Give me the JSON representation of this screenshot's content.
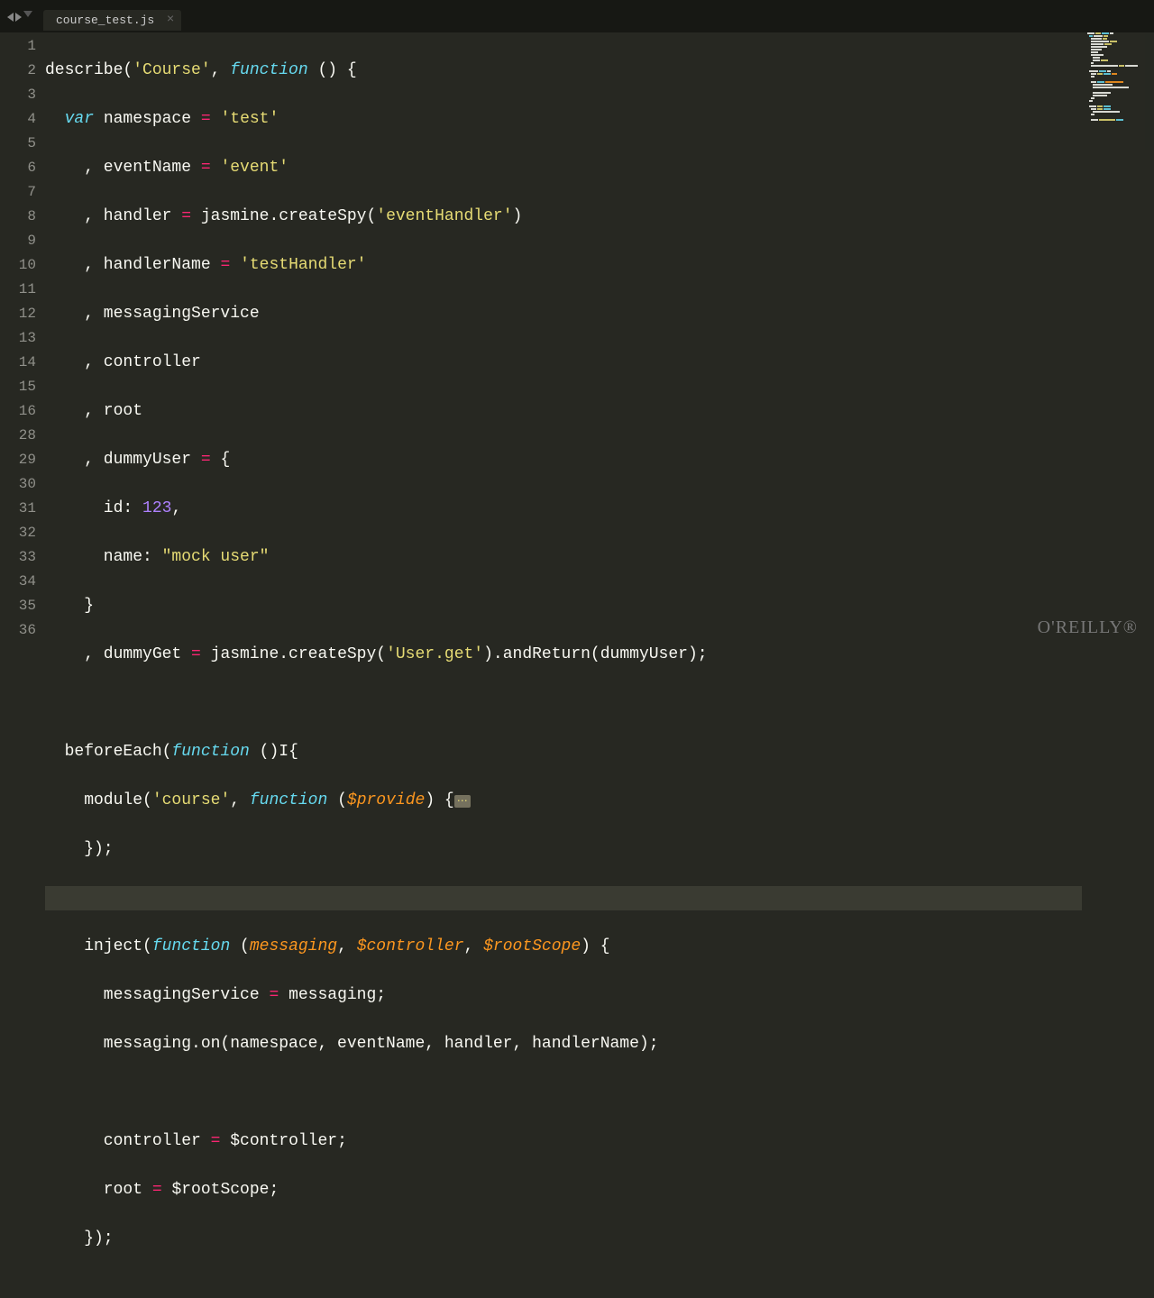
{
  "tab": {
    "name": "course_test.js"
  },
  "gutter": [
    "1",
    "2",
    "3",
    "4",
    "5",
    "6",
    "7",
    "8",
    "9",
    "10",
    "11",
    "12",
    "13",
    "14",
    "15",
    "16",
    "28",
    "29",
    "30",
    "31",
    "32",
    "33",
    "34",
    "35",
    "36"
  ],
  "code": {
    "l1": {
      "a": "describe(",
      "b": "'Course'",
      "c": ", ",
      "d": "function",
      "e": " () {"
    },
    "l2": {
      "a": "  ",
      "b": "var",
      "c": " namespace ",
      "d": "=",
      "e": " ",
      "f": "'test'"
    },
    "l3": {
      "a": "    , eventName ",
      "b": "=",
      "c": " ",
      "d": "'event'"
    },
    "l4": {
      "a": "    , handler ",
      "b": "=",
      "c": " jasmine.createSpy(",
      "d": "'eventHandler'",
      "e": ")"
    },
    "l5": {
      "a": "    , handlerName ",
      "b": "=",
      "c": " ",
      "d": "'testHandler'"
    },
    "l6": {
      "a": "    , messagingService"
    },
    "l7": {
      "a": "    , controller"
    },
    "l8": {
      "a": "    , root"
    },
    "l9": {
      "a": "    , dummyUser ",
      "b": "=",
      "c": " {"
    },
    "l10": {
      "a": "      id: ",
      "b": "123",
      "c": ","
    },
    "l11": {
      "a": "      name: ",
      "b": "\"mock user\""
    },
    "l12": {
      "a": "    }"
    },
    "l13": {
      "a": "    , dummyGet ",
      "b": "=",
      "c": " jasmine.createSpy(",
      "d": "'User.get'",
      "e": ").andReturn(dummyUser);"
    },
    "l14": {
      "a": ""
    },
    "l15": {
      "a": "  beforeEach(",
      "b": "function",
      "c": " ()",
      "cur": "I",
      "d": "{"
    },
    "l16": {
      "a": "    module(",
      "b": "'course'",
      "c": ", ",
      "d": "function",
      "e": " (",
      "f": "$provide",
      "g": ") {",
      "fold": "⋯"
    },
    "l28": {
      "a": "    });"
    },
    "l29": {
      "a": ""
    },
    "l30": {
      "a": "    inject(",
      "b": "function",
      "c": " (",
      "d": "messaging",
      "e": ", ",
      "f": "$controller",
      "g": ", ",
      "h": "$rootScope",
      "i": ") {"
    },
    "l31": {
      "a": "      messagingService ",
      "b": "=",
      "c": " messaging;"
    },
    "l32": {
      "a": "      messaging.on(namespace, eventName, handler, handlerName);"
    },
    "l33": {
      "a": ""
    },
    "l34": {
      "a": "      controller ",
      "b": "=",
      "c": " $controller;"
    },
    "l35": {
      "a": "      root ",
      "b": "=",
      "c": " $rootScope;"
    },
    "l36": {
      "a": "    });"
    }
  },
  "logo": "O'REILLY®"
}
